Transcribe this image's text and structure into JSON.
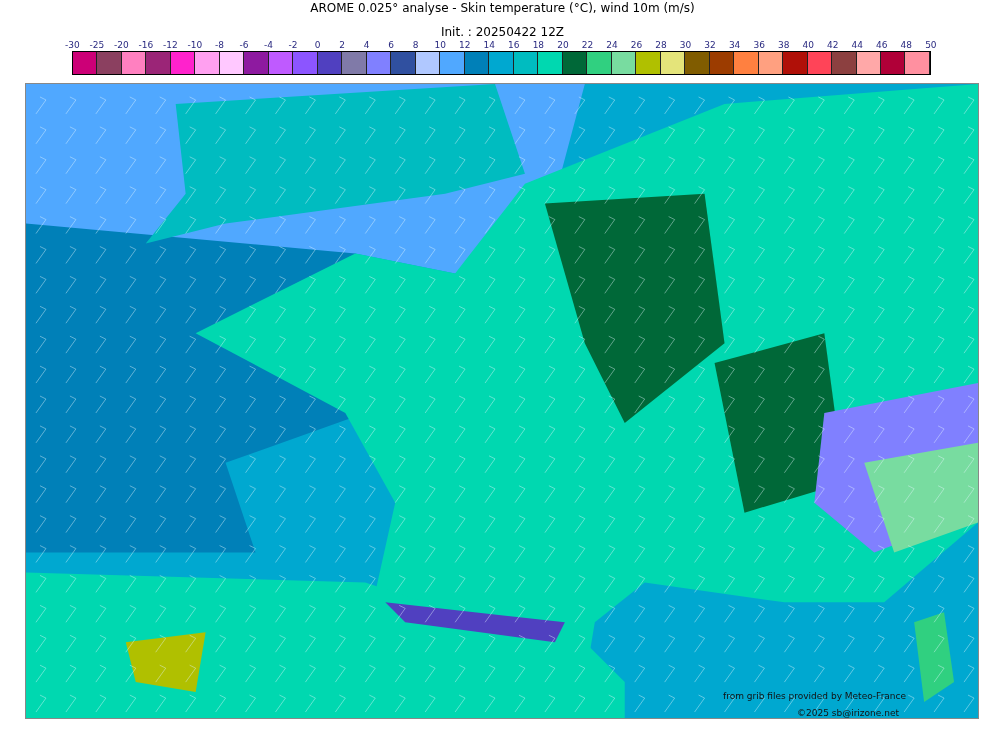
{
  "title": "AROME 0.025° analyse - Skin temperature (°C), wind 10m (m/s)",
  "subtitle": "Init. : 20250422 12Z",
  "colorbar": {
    "labels": [
      "-30",
      "-25",
      "-20",
      "-16",
      "-12",
      "-10",
      "-8",
      "-6",
      "-4",
      "-2",
      "0",
      "2",
      "4",
      "6",
      "8",
      "10",
      "12",
      "14",
      "16",
      "18",
      "20",
      "22",
      "24",
      "26",
      "28",
      "30",
      "32",
      "34",
      "36",
      "38",
      "40",
      "42",
      "44",
      "46",
      "48",
      "50"
    ],
    "swatches": [
      {
        "color": "#cc0077"
      },
      {
        "color": "#8b4060"
      },
      {
        "color": "#ff80c0"
      },
      {
        "color": "#9b2577"
      },
      {
        "color": "#ff22cc"
      },
      {
        "color": "#ffa0f0"
      },
      {
        "color": "#ffc8ff"
      },
      {
        "color": "#8e1aa0"
      },
      {
        "color": "#bf5aff"
      },
      {
        "color": "#8c55ff"
      },
      {
        "color": "#5040c0"
      },
      {
        "color": "#807aa8"
      },
      {
        "color": "#8080ff"
      },
      {
        "color": "#3050a0"
      },
      {
        "color": "#b0c8ff"
      },
      {
        "color": "#50a8ff"
      },
      {
        "color": "#0080b8"
      },
      {
        "color": "#00a8d0"
      },
      {
        "color": "#00bcc0"
      },
      {
        "color": "#00d8b0"
      },
      {
        "color": "#006838"
      },
      {
        "color": "#30d080"
      },
      {
        "color": "#78dca0"
      },
      {
        "color": "#b0c000"
      },
      {
        "color": "#e4e47a"
      },
      {
        "color": "#805c00"
      },
      {
        "color": "#9c3c00"
      },
      {
        "color": "#ff8040"
      },
      {
        "color": "#ffa080"
      },
      {
        "color": "#b01008"
      },
      {
        "color": "#ff4458"
      },
      {
        "color": "#8c4040"
      },
      {
        "color": "#ffa8a8"
      },
      {
        "color": "#b00038"
      },
      {
        "color": "#ff90a0"
      }
    ]
  },
  "credits": [
    "from grib files provided by Meteo-France",
    "©2025 sb@irizone.net"
  ]
}
